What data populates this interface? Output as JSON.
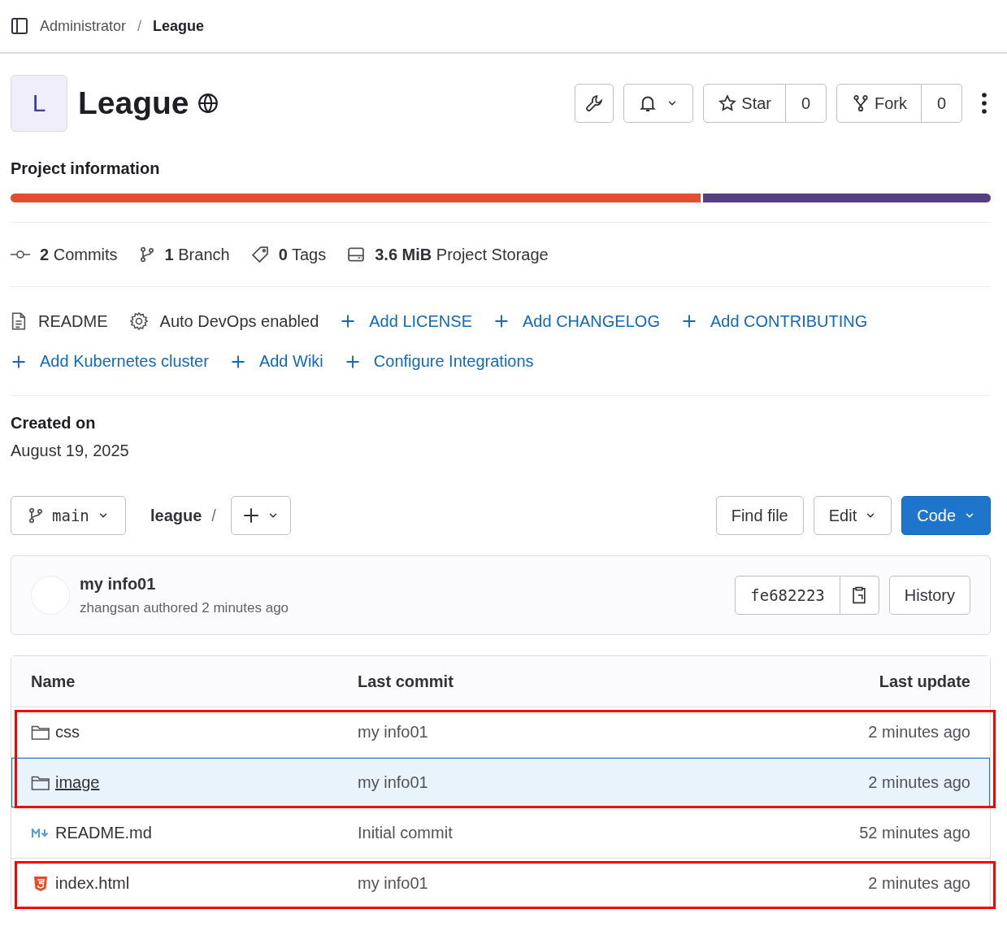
{
  "breadcrumb": {
    "separator": "/",
    "items": [
      {
        "label": "Administrator",
        "current": false
      },
      {
        "label": "League",
        "current": true
      }
    ]
  },
  "project": {
    "avatar_letter": "L",
    "name": "League",
    "star_label": "Star",
    "star_count": "0",
    "fork_label": "Fork",
    "fork_count": "0"
  },
  "project_information": {
    "title": "Project information",
    "language_bar": [
      {
        "color": "#e24e30",
        "level": 0.706
      },
      {
        "color": "#553f80",
        "level": 0.294
      }
    ]
  },
  "stats": [
    {
      "kind": "commits",
      "text": "**2** Commits"
    },
    {
      "kind": "branches",
      "text": "**1** Branch"
    },
    {
      "kind": "tags",
      "text": "**0** Tags"
    },
    {
      "kind": "storage",
      "text": "**3.6 MiB** Project Storage"
    }
  ],
  "links": [
    {
      "kind": "readme",
      "label": "README"
    },
    {
      "kind": "devops",
      "label": "Auto DevOps enabled"
    },
    {
      "kind": "add",
      "label": "Add LICENSE"
    },
    {
      "kind": "add",
      "label": "Add CHANGELOG"
    },
    {
      "kind": "add",
      "label": "Add CONTRIBUTING"
    },
    {
      "kind": "add",
      "label": "Add Kubernetes cluster"
    },
    {
      "kind": "add",
      "label": "Add Wiki"
    },
    {
      "kind": "add",
      "label": "Configure Integrations"
    }
  ],
  "created": {
    "label": "Created on",
    "date": "August 19, 2025"
  },
  "toolbar": {
    "branch": "main",
    "path": "league",
    "separator": "/",
    "find_file": "Find file",
    "edit": "Edit",
    "code": "Code"
  },
  "last_commit": {
    "title": "my info01",
    "author_line": "zhangsan authored 2 minutes ago",
    "sha": "fe682223",
    "history": "History"
  },
  "tree": {
    "columns": [
      "Name",
      "Last commit",
      "Last update"
    ],
    "rows": [
      {
        "kind": "folder",
        "name": "css",
        "commit": "my info01",
        "updated": "2 minutes ago",
        "hovered": false,
        "framed": true
      },
      {
        "kind": "folder",
        "name": "image",
        "commit": "my info01",
        "updated": "2 minutes ago",
        "hovered": true,
        "framed": true
      },
      {
        "kind": "markdown",
        "name": "README.md",
        "commit": "Initial commit",
        "updated": "52 minutes ago",
        "hovered": false,
        "framed": false
      },
      {
        "kind": "html",
        "name": "index.html",
        "commit": "my info01",
        "updated": "2 minutes ago",
        "hovered": false,
        "framed": true
      }
    ]
  }
}
